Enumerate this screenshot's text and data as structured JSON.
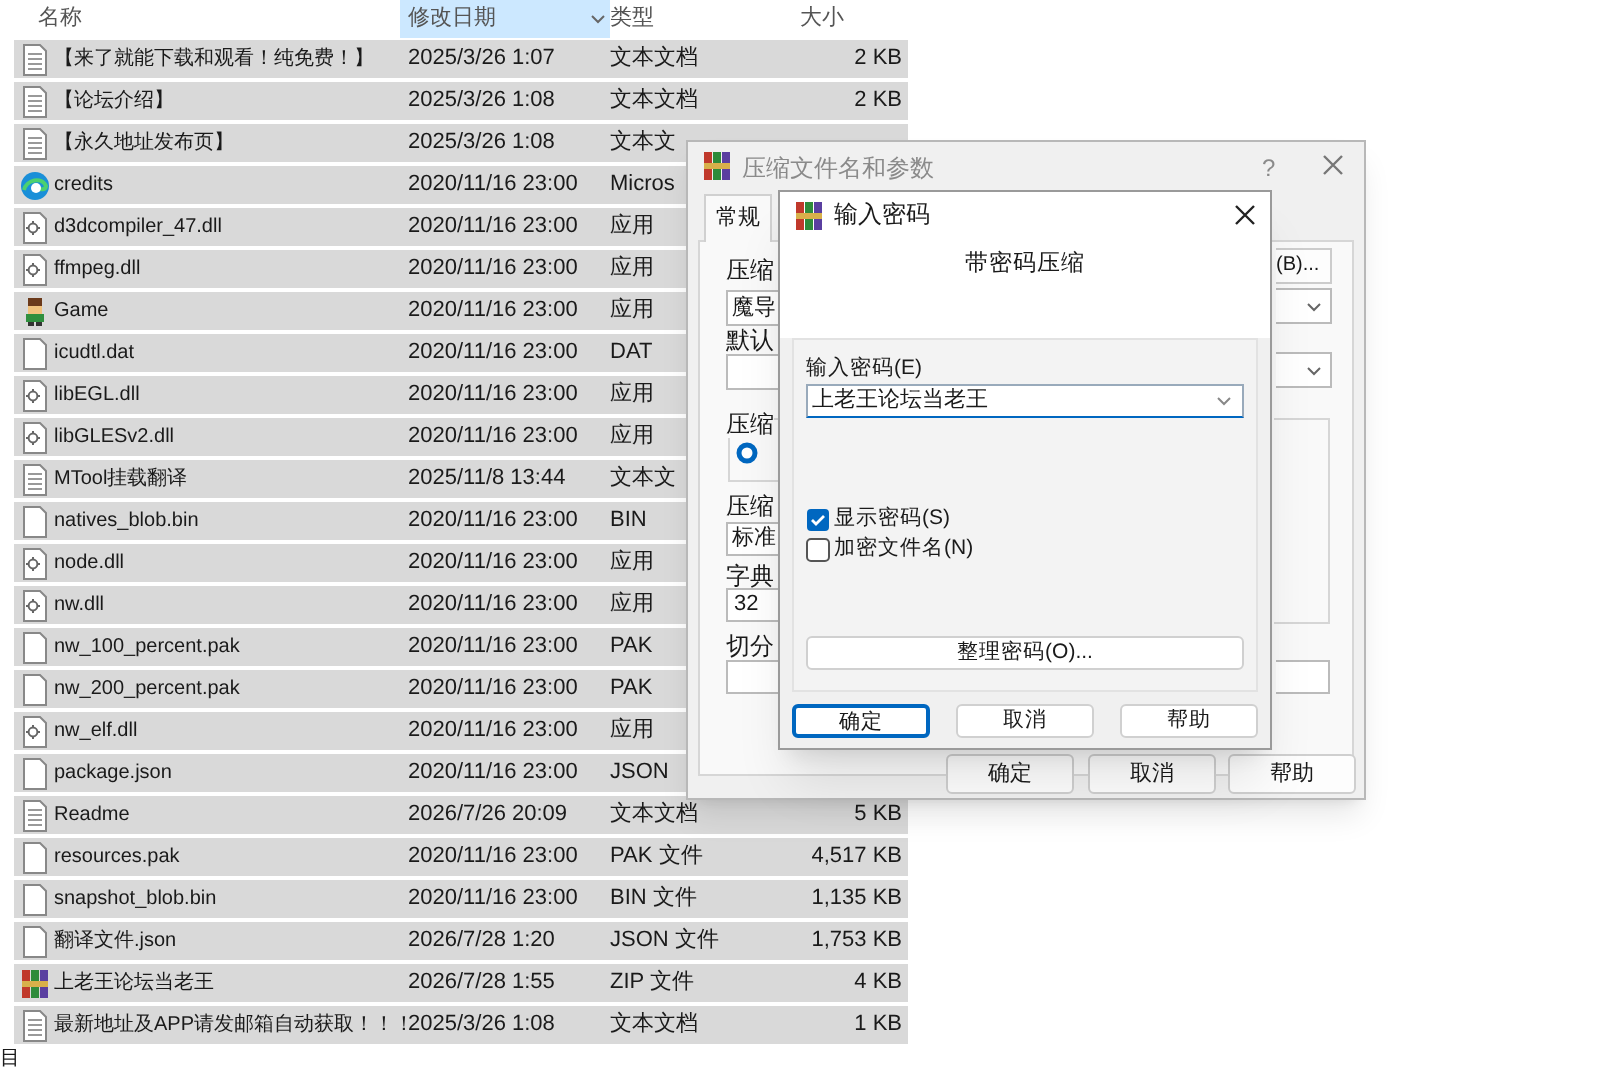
{
  "explorer": {
    "columns": [
      {
        "label": "名称",
        "sorted": false
      },
      {
        "label": "修改日期",
        "sorted": true
      },
      {
        "label": "类型",
        "sorted": false
      },
      {
        "label": "大小",
        "sorted": false
      }
    ],
    "rows": [
      {
        "kind": "text",
        "name": "【来了就能下载和观看！纯免费！】",
        "date": "2025/3/26 1:07",
        "type": "文本文档",
        "size": "2 KB"
      },
      {
        "kind": "text",
        "name": "【论坛介绍】",
        "date": "2025/3/26 1:08",
        "type": "文本文档",
        "size": "2 KB"
      },
      {
        "kind": "text",
        "name": "【永久地址发布页】",
        "date": "2025/3/26 1:08",
        "type": "文本文"
      },
      {
        "kind": "edge",
        "name": "credits",
        "date": "2020/11/16 23:00",
        "type": "Micros"
      },
      {
        "kind": "dll",
        "name": "d3dcompiler_47.dll",
        "date": "2020/11/16 23:00",
        "type": "应用"
      },
      {
        "kind": "dll",
        "name": "ffmpeg.dll",
        "date": "2020/11/16 23:00",
        "type": "应用"
      },
      {
        "kind": "game",
        "name": "Game",
        "date": "2020/11/16 23:00",
        "type": "应用"
      },
      {
        "kind": "file",
        "name": "icudtl.dat",
        "date": "2020/11/16 23:00",
        "type": "DAT"
      },
      {
        "kind": "dll",
        "name": "libEGL.dll",
        "date": "2020/11/16 23:00",
        "type": "应用"
      },
      {
        "kind": "dll",
        "name": "libGLESv2.dll",
        "date": "2020/11/16 23:00",
        "type": "应用"
      },
      {
        "kind": "text",
        "name": "MTool挂载翻译",
        "date": "2025/11/8 13:44",
        "type": "文本文"
      },
      {
        "kind": "file",
        "name": "natives_blob.bin",
        "date": "2020/11/16 23:00",
        "type": "BIN"
      },
      {
        "kind": "dll",
        "name": "node.dll",
        "date": "2020/11/16 23:00",
        "type": "应用"
      },
      {
        "kind": "dll",
        "name": "nw.dll",
        "date": "2020/11/16 23:00",
        "type": "应用"
      },
      {
        "kind": "file",
        "name": "nw_100_percent.pak",
        "date": "2020/11/16 23:00",
        "type": "PAK"
      },
      {
        "kind": "file",
        "name": "nw_200_percent.pak",
        "date": "2020/11/16 23:00",
        "type": "PAK"
      },
      {
        "kind": "dll",
        "name": "nw_elf.dll",
        "date": "2020/11/16 23:00",
        "type": "应用"
      },
      {
        "kind": "file",
        "name": "package.json",
        "date": "2020/11/16 23:00",
        "type": "JSON"
      },
      {
        "kind": "text",
        "name": "Readme",
        "date": "2026/7/26 20:09",
        "type": "文本文档",
        "size": "5 KB"
      },
      {
        "kind": "file",
        "name": "resources.pak",
        "date": "2020/11/16 23:00",
        "type": "PAK 文件",
        "size": "4,517 KB"
      },
      {
        "kind": "file",
        "name": "snapshot_blob.bin",
        "date": "2020/11/16 23:00",
        "type": "BIN 文件",
        "size": "1,135 KB"
      },
      {
        "kind": "file",
        "name": "翻译文件.json",
        "date": "2026/7/28 1:20",
        "type": "JSON 文件",
        "size": "1,753 KB"
      },
      {
        "kind": "archive",
        "name": "上老王论坛当老王",
        "date": "2026/7/28 1:55",
        "type": "ZIP 文件",
        "size": "4 KB"
      },
      {
        "kind": "text",
        "name": "最新地址及APP请发邮箱自动获取！！！",
        "date": "2025/3/26 1:08",
        "type": "文本文档",
        "size": "1 KB"
      }
    ],
    "status": "目"
  },
  "compress_dialog": {
    "title": "压缩文件名和参数",
    "help_mark": "?",
    "tabs": [
      {
        "label": "常规",
        "selected": true
      }
    ],
    "archive_label": "压缩",
    "archive_value": "魔导",
    "profile_label": "默认",
    "group_label": "压缩",
    "radio": {
      "selected": true
    },
    "method_label": "压缩",
    "method_value": "标准",
    "dict_label": "字典",
    "dict_value": "32",
    "split_label": "切分",
    "browse_button": "(B)...",
    "buttons": [
      "确定",
      "取消",
      "帮助"
    ]
  },
  "password_dialog": {
    "title": "输入密码",
    "subtitle": "带密码压缩",
    "password_label": "输入密码(E)",
    "password_value": "上老王论坛当老王",
    "checkboxes": [
      {
        "label": "显示密码(S)",
        "checked": true
      },
      {
        "label": "加密文件名(N)",
        "checked": false
      }
    ],
    "organize_button": "整理密码(O)...",
    "buttons": [
      {
        "label": "确定",
        "selected": true
      },
      {
        "label": "取消",
        "selected": false
      },
      {
        "label": "帮助",
        "selected": false
      }
    ]
  }
}
